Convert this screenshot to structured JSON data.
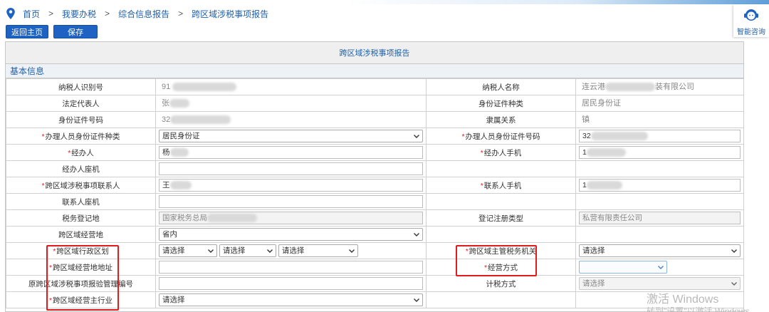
{
  "breadcrumb": [
    "首页",
    "我要办税",
    "综合信息报告",
    "跨区域涉税事项报告"
  ],
  "breadcrumb_sep": ">",
  "assistant_label": "智能咨询",
  "buttons": {
    "home": "返回主页",
    "save": "保存"
  },
  "form_title": "跨区域涉税事项报告",
  "section_title": "基本信息",
  "rows": {
    "r1": {
      "l1": "纳税人识别号",
      "v1": "91",
      "l2": "纳税人名称",
      "v2a": "连云港",
      "v2b": "装有限公司"
    },
    "r2": {
      "l1": "法定代表人",
      "v1": "张",
      "l2": "身份证件种类",
      "v2": "居民身份证"
    },
    "r3": {
      "l1": "身份证件号码",
      "v1": "32",
      "l2": "隶属关系",
      "v2": "镇"
    },
    "r4": {
      "l1": "办理人员身份证件种类",
      "v1": "居民身份证",
      "l2": "办理人员身份证件号码",
      "v2": "32"
    },
    "r5": {
      "l1": "经办人",
      "v1": "杨",
      "l2": "经办人手机",
      "v2": "1"
    },
    "r6": {
      "l1": "经办人座机"
    },
    "r7": {
      "l1": "跨区域涉税事项联系人",
      "v1": "王",
      "l2": "联系人手机",
      "v2": "1"
    },
    "r8": {
      "l1": "联系人座机"
    },
    "r9": {
      "l1": "税务登记地",
      "v1": "国家税务总局",
      "l2": "登记注册类型",
      "v2": "私营有限责任公司"
    },
    "r10": {
      "l1": "跨区域经营地",
      "v1": "省内"
    },
    "r11": {
      "l1": "跨区域行政区划",
      "s1": "请选择",
      "s2": "请选择",
      "s3": "请选择",
      "l2": "跨区域主管税务机关",
      "v2": "请选择"
    },
    "r12": {
      "l1": "跨区域经营地地址",
      "l2": "经营方式"
    },
    "r13": {
      "l1": "原跨区域涉税事项报验管理编号",
      "l2": "计税方式",
      "v2": "请选择"
    },
    "r14": {
      "l1": "跨区域经营主行业",
      "v1": "请选择"
    }
  },
  "required_mark": "*",
  "watermark": {
    "line1": "激活 Windows",
    "line2": "转到\"设置\"以激活 Windows。"
  },
  "colors": {
    "accent": "#1e63c4",
    "link": "#1f5fa8",
    "required": "#e02020",
    "highlight": "#e21c1c"
  }
}
